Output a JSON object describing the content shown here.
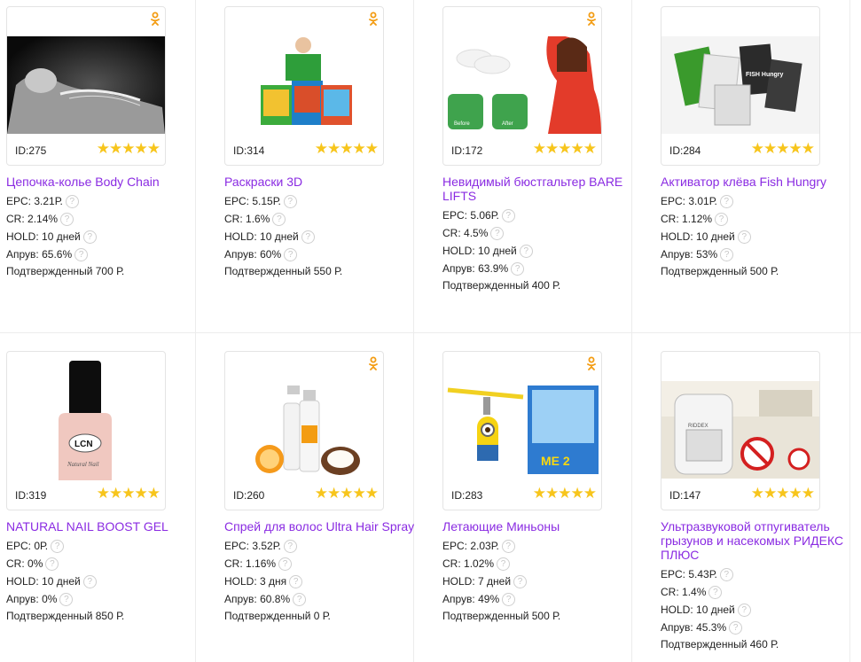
{
  "labels": {
    "epc": "EPC:",
    "cr": "CR:",
    "hold": "HOLD:",
    "approve": "Апрув:",
    "confirmed": "Подтвержденный",
    "help": "?"
  },
  "stars": "★★★★★",
  "offers": [
    {
      "id": "ID:275",
      "title": "Цепочка-колье Body Chain",
      "epc": "3.21Р.",
      "cr": "2.14%",
      "hold": "10 дней",
      "approve": "65.6%",
      "confirmed": "700 Р.",
      "image": "woman-bw-photo",
      "ok": true
    },
    {
      "id": "ID:314",
      "title": "Раскраски 3D",
      "epc": "5.15Р.",
      "cr": "1.6%",
      "hold": "10 дней",
      "approve": "60%",
      "confirmed": "550 Р.",
      "image": "coloring-books-photo",
      "ok": true
    },
    {
      "id": "ID:172",
      "title": "Невидимый бюстгальтер BARE LIFTS",
      "epc": "5.06Р.",
      "cr": "4.5%",
      "hold": "10 дней",
      "approve": "63.9%",
      "confirmed": "400 Р.",
      "image": "bra-lifts-photo",
      "ok": true,
      "before": "Before",
      "after": "After"
    },
    {
      "id": "ID:284",
      "title": "Активатор клёва Fish Hungry",
      "epc": "3.01Р.",
      "cr": "1.12%",
      "hold": "10 дней",
      "approve": "53%",
      "confirmed": "500 Р.",
      "image": "fish-hungry-packs-photo",
      "ok": false,
      "pack_text": "FISH Hungry"
    },
    {
      "id": "ID:319",
      "title": "NATURAL NAIL BOOST GEL",
      "epc": "0Р.",
      "cr": "0%",
      "hold": "10 дней",
      "approve": "0%",
      "confirmed": "850 Р.",
      "image": "nail-gel-bottle-photo",
      "ok": false,
      "brand": "LCN",
      "product": "Natural Nail"
    },
    {
      "id": "ID:260",
      "title": "Спрей для волос Ultra Hair Spray",
      "epc": "3.52Р.",
      "cr": "1.16%",
      "hold": "3 дня",
      "approve": "60.8%",
      "confirmed": "0 Р.",
      "image": "hair-spray-photo",
      "ok": true
    },
    {
      "id": "ID:283",
      "title": "Летающие Миньоны",
      "epc": "2.03Р.",
      "cr": "1.02%",
      "hold": "7 дней",
      "approve": "49%",
      "confirmed": "500 Р.",
      "image": "flying-minion-photo",
      "ok": true,
      "box_text": "ME 2"
    },
    {
      "id": "ID:147",
      "title": "Ультразвуковой отпугиватель грызунов и насекомых РИДЕКС ПЛЮС",
      "epc": "5.43Р.",
      "cr": "1.4%",
      "hold": "10 дней",
      "approve": "45.3%",
      "confirmed": "460 Р.",
      "image": "riddex-repeller-photo",
      "ok": false,
      "device_text": "RIDDEX"
    }
  ],
  "colors": {
    "title": "#8a2be2",
    "stars": "#f7c51c",
    "ok_icon": "#f39c12",
    "border": "#e4e4e4"
  }
}
